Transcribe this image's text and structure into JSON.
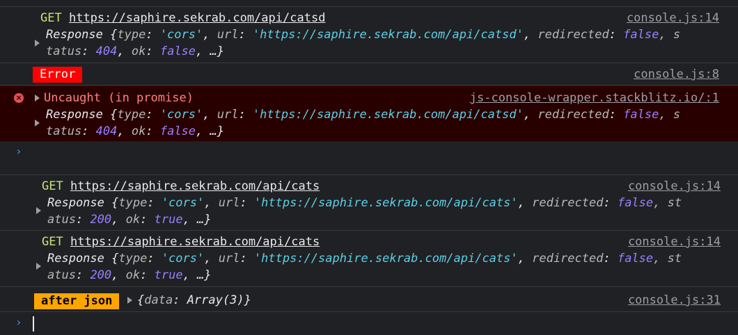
{
  "messages": [
    {
      "method": "GET",
      "url": "https://saphire.sekrab.com/api/catsd",
      "source": "console.js:14",
      "line1": {
        "cls": "Response",
        "brace": " {",
        "k1": "type",
        "v1": "'cors'",
        "k2": "url",
        "v2": "'https://saphire.sekrab.com/api/catsd'",
        "k3": "redirected",
        "v3": "false",
        "tail": ", s"
      },
      "line2": {
        "k4a": "tatus",
        "v4": "404",
        "k5": "ok",
        "v5": "false",
        "end": ", …}"
      }
    },
    {
      "badge": "Error",
      "source": "console.js:8"
    },
    {
      "error_title": "Uncaught (in promise)",
      "source": "js-console-wrapper.stackblitz.io/:1",
      "line1": {
        "cls": "Response",
        "brace": " {",
        "k1": "type",
        "v1": "'cors'",
        "k2": "url",
        "v2": "'https://saphire.sekrab.com/api/catsd'",
        "k3": "redirected",
        "v3": "false",
        "tail": ", s"
      },
      "line2": {
        "k4a": "tatus",
        "v4": "404",
        "k5": "ok",
        "v5": "false",
        "end": ", …}"
      }
    },
    {
      "method": "GET",
      "url": "https://saphire.sekrab.com/api/cats",
      "source": "console.js:14",
      "line1": {
        "cls": "Response",
        "brace": " {",
        "k1": "type",
        "v1": "'cors'",
        "k2": "url",
        "v2": "'https://saphire.sekrab.com/api/cats'",
        "k3": "redirected",
        "v3": "false",
        "tail": ", st"
      },
      "line2": {
        "k4a": "atus",
        "v4": "200",
        "k5": "ok",
        "v5": "true",
        "end": ", …}"
      }
    },
    {
      "method": "GET",
      "url": "https://saphire.sekrab.com/api/cats",
      "source": "console.js:14",
      "line1": {
        "cls": "Response",
        "brace": " {",
        "k1": "type",
        "v1": "'cors'",
        "k2": "url",
        "v2": "'https://saphire.sekrab.com/api/cats'",
        "k3": "redirected",
        "v3": "false",
        "tail": ", st"
      },
      "line2": {
        "k4a": "atus",
        "v4": "200",
        "k5": "ok",
        "v5": "true",
        "end": ", …}"
      }
    },
    {
      "badge": "after json",
      "object": {
        "open": "{",
        "k": "data",
        "v": "Array(3)",
        "close": "}"
      },
      "source": "console.js:31"
    }
  ],
  "prompt_glyph": "›",
  "error_icon_glyph": "×",
  "colors": {
    "background": "#202124",
    "error_bg": "#290000",
    "error_badge": "#ff0000",
    "after_json_badge": "#ffa500",
    "string": "#5ccfe6",
    "keyword": "#9980ff",
    "method": "#c5e478"
  }
}
